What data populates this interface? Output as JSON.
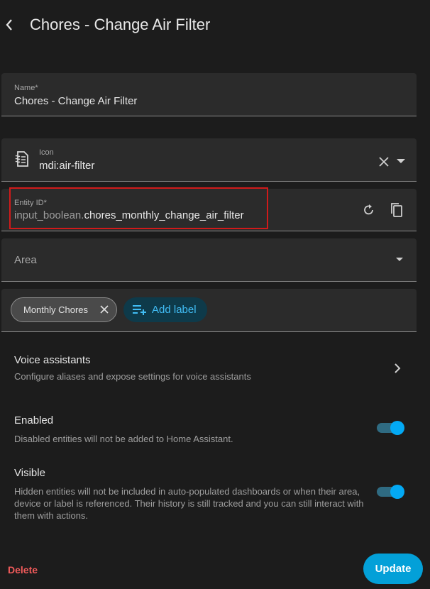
{
  "header": {
    "title": "Chores - Change Air Filter"
  },
  "name_field": {
    "label": "Name*",
    "value": "Chores - Change Air Filter"
  },
  "icon_field": {
    "label": "Icon",
    "value": "mdi:air-filter",
    "icon": "air-filter-icon"
  },
  "entity_field": {
    "label": "Entity ID*",
    "prefix": "input_boolean.",
    "suffix": "chores_monthly_change_air_filter"
  },
  "area_field": {
    "placeholder": "Area"
  },
  "labels": {
    "chips": [
      {
        "label": "Monthly Chores"
      }
    ],
    "add_label": "Add label"
  },
  "voice": {
    "title": "Voice assistants",
    "description": "Configure aliases and expose settings for voice assistants"
  },
  "enabled": {
    "title": "Enabled",
    "description": "Disabled entities will not be added to Home Assistant.",
    "on": true
  },
  "visible": {
    "title": "Visible",
    "description": "Hidden entities will not be included in auto-populated dashboards or when their area, device or label is referenced. Their history is still tracked and you can still interact with them with actions.",
    "on": true
  },
  "footer": {
    "delete_label": "Delete",
    "update_label": "Update"
  },
  "colors": {
    "accent": "#03a9f4",
    "danger": "#ef5a5a",
    "highlight": "#d11a1a"
  }
}
